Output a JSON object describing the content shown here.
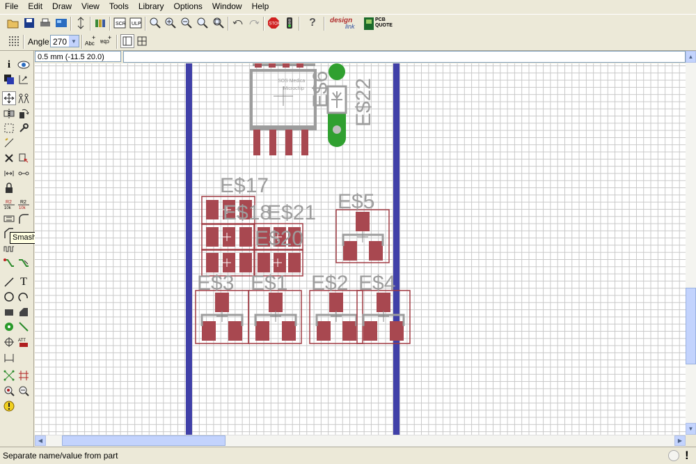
{
  "menu": [
    "File",
    "Edit",
    "Draw",
    "View",
    "Tools",
    "Library",
    "Options",
    "Window",
    "Help"
  ],
  "param_toolbar": {
    "angle_label": "Angle:",
    "angle_value": "270"
  },
  "coordinate_display": "0.5 mm (-11.5 20.0)",
  "tooltip": "Smash",
  "status_text": "Separate name/value from part",
  "toolbar_logos": {
    "design": "design",
    "link": "link",
    "pcb": "PCB",
    "quote": "QUOTE"
  },
  "canvas": {
    "chip_labels": [
      "SOS Medica",
      "Microchip"
    ],
    "part_names": [
      "E$17",
      "E$18",
      "E$21",
      "E$20",
      "E$5",
      "E$3",
      "E$1",
      "E$2",
      "E$4",
      "E$22",
      "E$6"
    ]
  },
  "colors": {
    "board_edge": "#4040a8",
    "pad": "#a84850",
    "outline": "#a03a42",
    "silkscreen": "#9d9d9d",
    "via": "#30a030"
  }
}
